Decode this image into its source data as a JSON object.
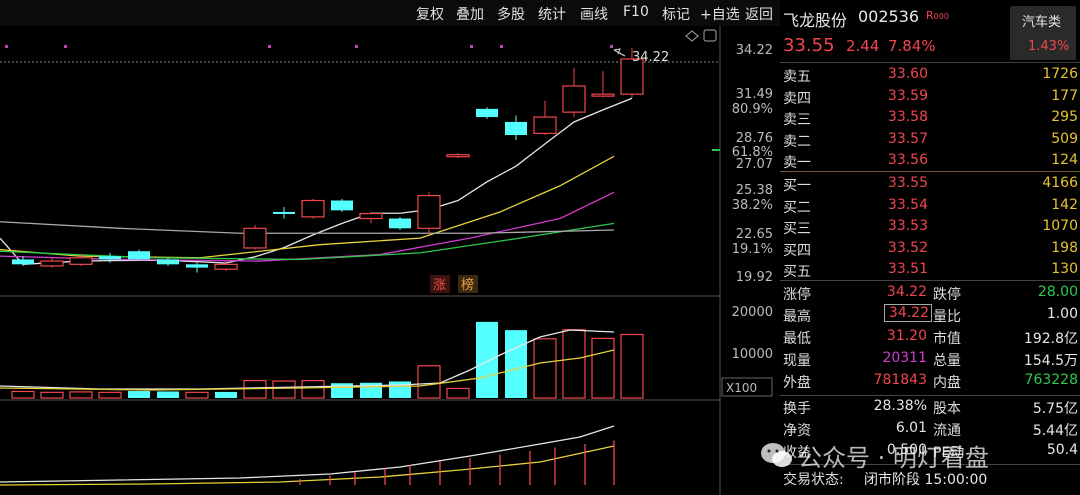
{
  "toolbar": {
    "items": [
      "复权",
      "叠加",
      "多股",
      "统计",
      "画线",
      "F10",
      "标记",
      "+自选",
      "返回"
    ]
  },
  "price_axis": {
    "ticks": [
      "34.22",
      "31.49",
      "28.76",
      "27.07",
      "25.38",
      "22.65",
      "19.92"
    ],
    "pct_ticks": [
      "80.9%",
      "61.8%",
      "38.2%",
      "19.1%"
    ]
  },
  "high_annotation": "34.22",
  "badges": [
    "涨",
    "榜"
  ],
  "volume_axis": {
    "ticks": [
      "20000",
      "10000"
    ],
    "unit": "X100"
  },
  "stock": {
    "name": "飞龙股份",
    "code": "002536",
    "tag": "R",
    "tag_small": "000",
    "price": "33.55",
    "change": "2.44",
    "change_pct": "7.84%"
  },
  "sector": {
    "name": "汽车类",
    "change_pct": "1.43%"
  },
  "asks": [
    {
      "label": "卖五",
      "price": "33.60",
      "vol": "1726"
    },
    {
      "label": "卖四",
      "price": "33.59",
      "vol": "177"
    },
    {
      "label": "卖三",
      "price": "33.58",
      "vol": "295"
    },
    {
      "label": "卖二",
      "price": "33.57",
      "vol": "509"
    },
    {
      "label": "卖一",
      "price": "33.56",
      "vol": "124"
    }
  ],
  "bids": [
    {
      "label": "买一",
      "price": "33.55",
      "vol": "4166"
    },
    {
      "label": "买二",
      "price": "33.54",
      "vol": "142"
    },
    {
      "label": "买三",
      "price": "33.53",
      "vol": "1070"
    },
    {
      "label": "买四",
      "price": "33.52",
      "vol": "198"
    },
    {
      "label": "买五",
      "price": "33.51",
      "vol": "130"
    }
  ],
  "stats": {
    "limit_up_label": "涨停",
    "limit_up": "34.22",
    "limit_down_label": "跌停",
    "limit_down": "28.00",
    "high_label": "最高",
    "high": "34.22",
    "vol_ratio_label": "量比",
    "vol_ratio": "1.00",
    "low_label": "最低",
    "low": "31.20",
    "mktcap_label": "市值",
    "mktcap": "192.8亿",
    "cur_vol_label": "现量",
    "cur_vol": "20311",
    "total_vol_label": "总量",
    "total_vol": "154.5万",
    "outer_label": "外盘",
    "outer": "781843",
    "inner_label": "内盘",
    "inner": "763228",
    "turnover_label": "换手",
    "turnover": "28.38%",
    "share_cap_label": "股本",
    "share_cap": "5.75亿",
    "nav_label": "净资",
    "nav": "6.01",
    "float_label": "流通",
    "float_cap": "5.44亿",
    "income_label": "收益",
    "income": "0.500",
    "pe_label": "PE动",
    "pe": "50.4",
    "status_label": "交易状态:",
    "status": "闭市阶段 15:00:00"
  },
  "watermark": "公众号 · 明灯看盘",
  "chart_data": {
    "type": "candlestick",
    "candles": [
      {
        "o": 21.3,
        "c": 21.0,
        "h": 21.5,
        "l": 20.9
      },
      {
        "o": 20.9,
        "c": 21.2,
        "h": 21.4,
        "l": 20.8
      },
      {
        "o": 21.0,
        "c": 21.4,
        "h": 21.6,
        "l": 20.9
      },
      {
        "o": 21.5,
        "c": 21.3,
        "h": 21.7,
        "l": 21.1
      },
      {
        "o": 21.8,
        "c": 21.3,
        "h": 21.9,
        "l": 21.2
      },
      {
        "o": 21.3,
        "c": 21.0,
        "h": 21.4,
        "l": 20.9
      },
      {
        "o": 21.0,
        "c": 20.8,
        "h": 21.1,
        "l": 20.5
      },
      {
        "o": 20.7,
        "c": 21.0,
        "h": 21.2,
        "l": 20.6
      },
      {
        "o": 22.0,
        "c": 23.2,
        "h": 23.4,
        "l": 21.9
      },
      {
        "o": 24.2,
        "c": 24.1,
        "h": 24.5,
        "l": 23.8
      },
      {
        "o": 23.9,
        "c": 24.9,
        "h": 25.0,
        "l": 23.8
      },
      {
        "o": 24.9,
        "c": 24.3,
        "h": 25.0,
        "l": 24.2
      },
      {
        "o": 23.8,
        "c": 24.1,
        "h": 24.2,
        "l": 23.5
      },
      {
        "o": 23.8,
        "c": 23.2,
        "h": 23.9,
        "l": 23.1
      },
      {
        "o": 23.2,
        "c": 25.2,
        "h": 25.4,
        "l": 22.8
      },
      {
        "o": 27.6,
        "c": 27.7,
        "h": 27.8,
        "l": 27.5
      },
      {
        "o": 30.5,
        "c": 30.0,
        "h": 30.6,
        "l": 29.9
      },
      {
        "o": 29.7,
        "c": 28.9,
        "h": 30.1,
        "l": 28.6
      },
      {
        "o": 29.0,
        "c": 30.0,
        "h": 31.0,
        "l": 28.9
      },
      {
        "o": 30.3,
        "c": 31.9,
        "h": 33.0,
        "l": 30.0
      },
      {
        "o": 31.3,
        "c": 31.4,
        "h": 32.8,
        "l": 31.2
      },
      {
        "o": 31.4,
        "c": 33.55,
        "h": 34.22,
        "l": 31.2
      }
    ],
    "volume_up": [
      false,
      false,
      false,
      false,
      true,
      true,
      false,
      true,
      false,
      false,
      false,
      true,
      true,
      true,
      false,
      false,
      true,
      true,
      false,
      false,
      false,
      false
    ],
    "volume": [
      1500,
      1300,
      1400,
      1300,
      1600,
      1500,
      1300,
      1400,
      4000,
      3900,
      4000,
      3400,
      3500,
      3800,
      7400,
      2200,
      17500,
      15600,
      13600,
      15700,
      13700,
      14600
    ]
  }
}
